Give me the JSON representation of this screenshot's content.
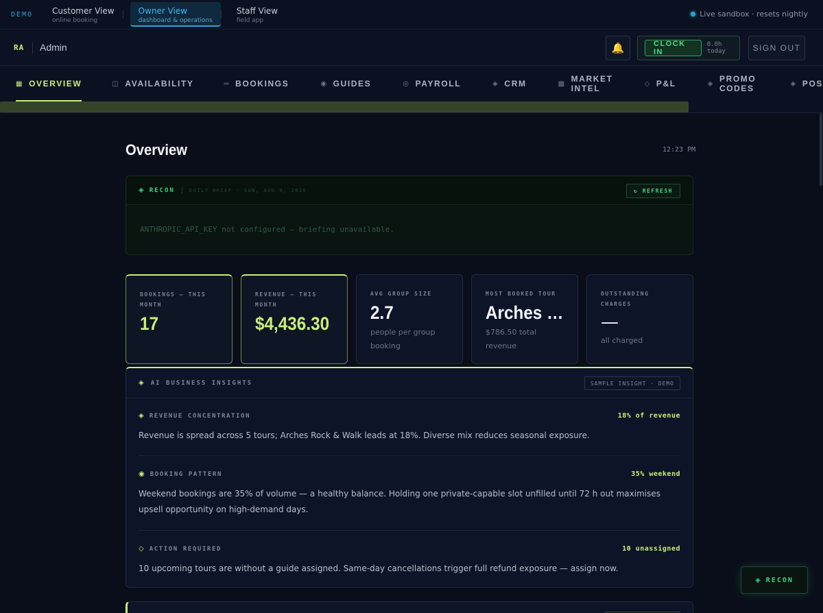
{
  "demo_bar": {
    "tag": "DEMO",
    "views": [
      {
        "label": "Customer View",
        "sub": "online booking"
      },
      {
        "label": "Owner View",
        "sub": "dashboard & operations"
      },
      {
        "label": "Staff View",
        "sub": "field app"
      }
    ],
    "sandbox_status": "Live sandbox · resets nightly"
  },
  "header": {
    "initials": "RA",
    "role": "Admin",
    "bell_icon": "🔔",
    "clock_in_label": "CLOCK IN",
    "hours_today": "0.0h today",
    "sign_out_label": "SIGN OUT"
  },
  "nav": {
    "items": [
      {
        "icon": "▦",
        "label": "OVERVIEW"
      },
      {
        "icon": "◫",
        "label": "AVAILABILITY"
      },
      {
        "icon": "═",
        "label": "BOOKINGS"
      },
      {
        "icon": "◉",
        "label": "GUIDES"
      },
      {
        "icon": "◎",
        "label": "PAYROLL"
      },
      {
        "icon": "◈",
        "label": "CRM"
      },
      {
        "icon": "▩",
        "label": "MARKET INTEL"
      },
      {
        "icon": "◇",
        "label": "P&L"
      },
      {
        "icon": "◈",
        "label": "PROMO CODES"
      },
      {
        "icon": "◈",
        "label": "POS"
      }
    ]
  },
  "main": {
    "title": "Overview",
    "time": "12:23 PM"
  },
  "recon": {
    "mark": "◈",
    "title": "RECON",
    "subtitle": "DAILY BRIEF · SUN, AUG 9, 2026",
    "refresh_label": "↻ REFRESH",
    "message": "ANTHROPIC_API_KEY not configured — briefing unavailable."
  },
  "stats": [
    {
      "label": "BOOKINGS — THIS MONTH",
      "value": "17",
      "sub": ""
    },
    {
      "label": "REVENUE — THIS MONTH",
      "value": "$4,436.30",
      "sub": ""
    },
    {
      "label": "AVG GROUP SIZE",
      "value": "2.7",
      "sub": "people per group booking"
    },
    {
      "label": "MOST BOOKED TOUR",
      "value": "Arches Rock & Walk",
      "sub": "$786.50 total revenue"
    },
    {
      "label": "OUTSTANDING CHARGES",
      "value": "—",
      "sub": "all charged"
    }
  ],
  "insights": {
    "mark": "◈",
    "title": "AI BUSINESS INSIGHTS",
    "badge": "SAMPLE INSIGHT · DEMO",
    "items": [
      {
        "icon": "◈",
        "title": "REVENUE CONCENTRATION",
        "metric": "18% of revenue",
        "body": "Revenue is spread across 5 tours; Arches Rock & Walk leads at 18%. Diverse mix reduces seasonal exposure."
      },
      {
        "icon": "◉",
        "title": "BOOKING PATTERN",
        "metric": "35% weekend",
        "body": "Weekend bookings are 35% of volume — a healthy balance. Holding one private-capable slot unfilled until 72 h out maximises upsell opportunity on high-demand days."
      },
      {
        "icon": "◇",
        "title": "ACTION REQUIRED",
        "metric": "10 unassigned",
        "body": "10 upcoming tours are without a guide assigned. Same-day cancellations trigger full refund exposure — assign now."
      }
    ]
  },
  "fab": {
    "mark": "◈",
    "label": "RECON"
  },
  "colors": {
    "accent": "#c8f07a",
    "recon_green": "#3fd482",
    "info_blue": "#2aa4d8",
    "background": "#0a0e1a"
  }
}
